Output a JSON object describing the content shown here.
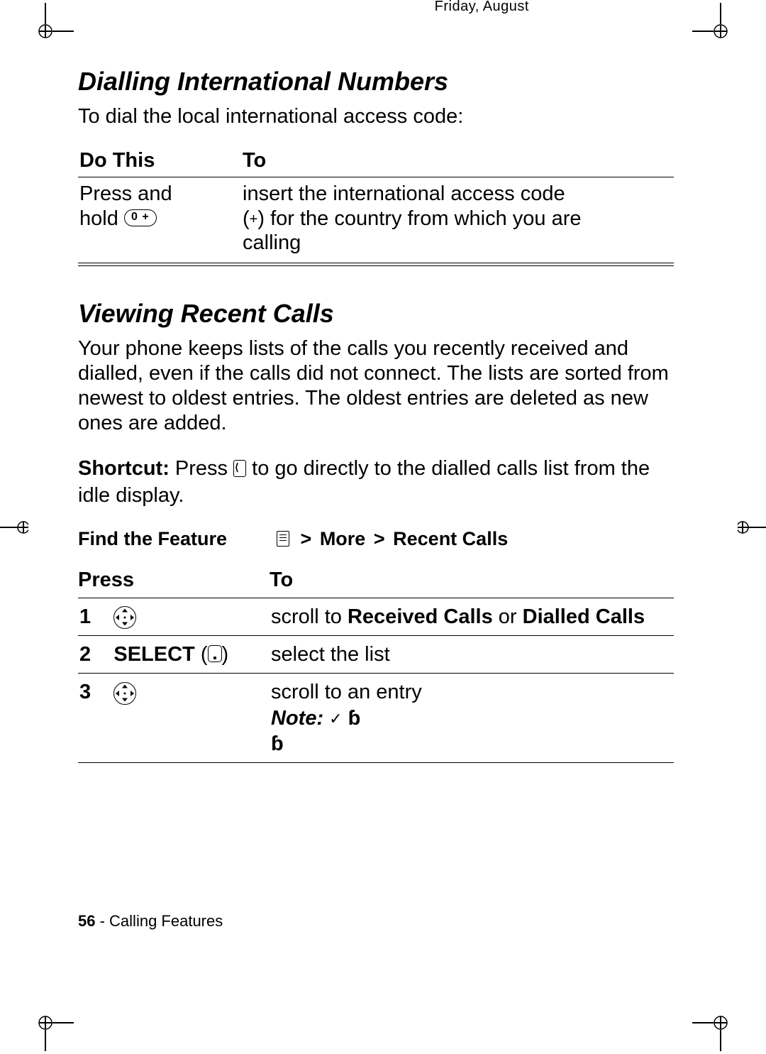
{
  "header_trace": "Friday, August",
  "sections": {
    "dialling": {
      "title": "Dialling International Numbers",
      "intro": "To dial the local international access code:",
      "table": {
        "h_do": "Do This",
        "h_to": "To",
        "do_line1": "Press and",
        "do_line2_prefix": "hold",
        "zero_key": "0 +",
        "to_line1": "insert the international access code",
        "to_line2_prefix": "(",
        "to_line2_plus": "+",
        "to_line2_suffix": ") for the country from which you are",
        "to_line3": "calling"
      }
    },
    "recent": {
      "title": "Viewing Recent Calls",
      "para": "Your phone keeps lists of the calls you recently received and dialled, even if the calls did not connect. The lists are sorted from newest to oldest entries. The oldest entries are deleted as new ones are added.",
      "shortcut_label": "Shortcut:",
      "shortcut_text_pre": " Press ",
      "shortcut_text_post": " to go directly to the dialled calls list from the idle display.",
      "find_label": "Find the Feature",
      "path_more": "More",
      "path_sep": ">",
      "path_recent": "Recent Calls",
      "table": {
        "h_press": "Press",
        "h_to": "To",
        "step1": "1",
        "r1_to_pre": "scroll to ",
        "r1_to_a": "Received Calls",
        "r1_to_mid": " or ",
        "r1_to_b": "Dialled Calls",
        "step2": "2",
        "r2_press": "SELECT",
        "r2_to": "select the list",
        "step3": "3",
        "r3_to": "scroll to an entry",
        "note_label": "Note:"
      }
    }
  },
  "footer": {
    "page_num": "56",
    "sep": " - ",
    "chapter": "Calling Features"
  }
}
